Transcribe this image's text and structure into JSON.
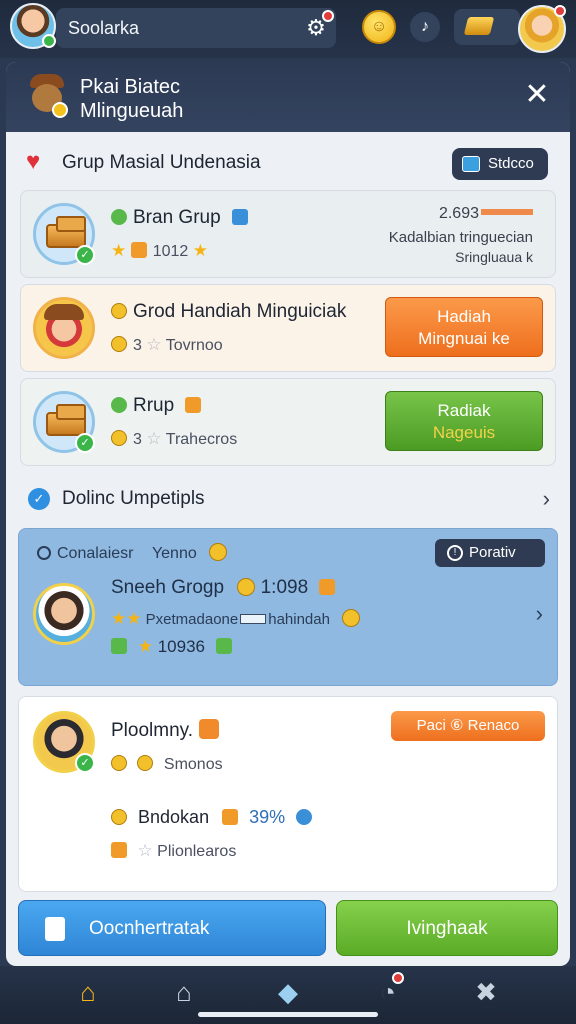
{
  "topbar": {
    "player_name": "Soolarka",
    "gear_glyph": "⚙",
    "music_glyph": "♪"
  },
  "modal": {
    "title_line1": "Pkai Biatec",
    "title_line2": "Mlingueuah",
    "close_glyph": "✕",
    "section_title": "Grup Masial Undenasia",
    "status_button": "Stdcco"
  },
  "rows": [
    {
      "name": "Bran Grup",
      "meta_value": "1012",
      "right_value": "2.693",
      "right_line2": "Kadalbian tringuecian",
      "right_line3": "Sringluaua   k"
    },
    {
      "name": "Grod Handiah Minguiciak",
      "meta_value": "3",
      "meta_label": "Tovrnoo",
      "button_line1": "Hadiah",
      "button_line2": "Mingnuai ke"
    },
    {
      "name": "Rrup",
      "meta_value": "3",
      "meta_label": "Trahecros",
      "button_line1": "Radiak",
      "button_line2": "Nageuis"
    }
  ],
  "online": {
    "title": "Dolinc Umpetipls",
    "chevron": "›"
  },
  "blue_panel": {
    "label": "Conalaiesr",
    "label2": "Yenno",
    "priority_button": "Porativ",
    "name": "Sneeh Grogp",
    "value": "1:098",
    "sub_left": "Pxetmadaone",
    "sub_right": "hahindah",
    "stats_value": "10936"
  },
  "white_panel": {
    "name": "Ploolmny.",
    "orange_button": "Paci ⑥ Renaco",
    "line1": "Smonos",
    "line2_label": "Bndokan",
    "line2_pct": "39%",
    "line3": "Plionlearos"
  },
  "bottom_buttons": {
    "left": "Oocnhertratak",
    "right": "Ivinghaak"
  },
  "nav": {
    "home": "⌂",
    "shop": "⌂",
    "cube": "◆",
    "chat": "◔",
    "tools": "✖"
  },
  "colors": {
    "orange_button": "#ee6f1e",
    "green_button": "#4c9b23",
    "blue_panel": "#8fb9e0",
    "header": "#2c3a54"
  }
}
